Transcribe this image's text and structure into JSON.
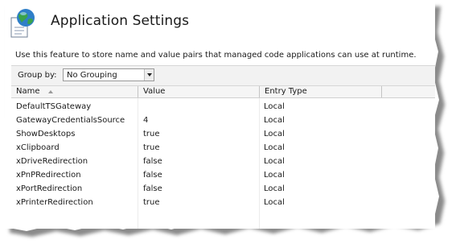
{
  "title": "Application Settings",
  "description": "Use this feature to store name and value pairs that managed code applications can use at runtime.",
  "group_by": {
    "label": "Group by:",
    "value": "No Grouping"
  },
  "columns": [
    "Name",
    "Value",
    "Entry Type"
  ],
  "rows": [
    {
      "name": "DefaultTSGateway",
      "value": "",
      "type": "Local"
    },
    {
      "name": "GatewayCredentialsSource",
      "value": "4",
      "type": "Local"
    },
    {
      "name": "ShowDesktops",
      "value": "true",
      "type": "Local"
    },
    {
      "name": "xClipboard",
      "value": "true",
      "type": "Local"
    },
    {
      "name": "xDriveRedirection",
      "value": "false",
      "type": "Local"
    },
    {
      "name": "xPnPRedirection",
      "value": "false",
      "type": "Local"
    },
    {
      "name": "xPortRedirection",
      "value": "false",
      "type": "Local"
    },
    {
      "name": "xPrinterRedirection",
      "value": "true",
      "type": "Local"
    }
  ],
  "icons": {
    "app": "globe-document-icon",
    "sort": "sort-ascending-icon",
    "dropdown": "chevron-down-icon"
  }
}
